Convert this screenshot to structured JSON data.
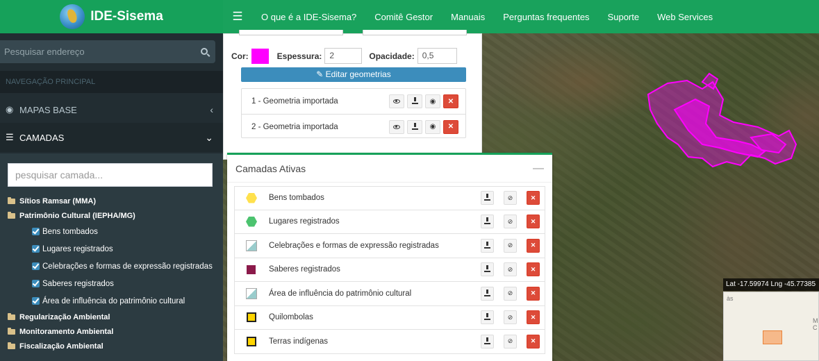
{
  "app": {
    "title": "IDE-Sisema"
  },
  "topnav": {
    "menu_icon": "hamburger-icon",
    "items": [
      "O que é a IDE-Sisema?",
      "Comitê Gestor",
      "Manuais",
      "Perguntas frequentes",
      "Suporte",
      "Web Services"
    ]
  },
  "sidebar": {
    "address_search": {
      "placeholder": "Pesquisar endereço",
      "icon": "search-icon"
    },
    "section_header": "NAVEGAÇÃO PRINCIPAL",
    "mapas_base": {
      "label": "MAPAS BASE",
      "icon": "globe-icon",
      "chevron": "‹"
    },
    "camadas": {
      "label": "CAMADAS",
      "icon": "list-icon",
      "chevron": "⌄"
    },
    "layer_search": {
      "placeholder": "pesquisar camada..."
    },
    "tree": [
      {
        "label": "Sítios Ramsar (MMA)",
        "type": "folder"
      },
      {
        "label": "Patrimônio Cultural (IEPHA/MG)",
        "type": "folder-open"
      },
      {
        "label": "Bens tombados",
        "type": "checked"
      },
      {
        "label": "Lugares registrados",
        "type": "checked"
      },
      {
        "label": "Celebrações e formas de expressão registradas",
        "type": "checked"
      },
      {
        "label": "Saberes registrados",
        "type": "checked"
      },
      {
        "label": "Área de influência do patrimônio cultural",
        "type": "checked"
      },
      {
        "label": "Regularização Ambiental",
        "type": "folder"
      },
      {
        "label": "Monitoramento Ambiental",
        "type": "folder"
      },
      {
        "label": "Fiscalização Ambiental",
        "type": "folder"
      }
    ]
  },
  "draw_panel": {
    "color_label": "Cor:",
    "color_value": "#ff00ff",
    "thickness_label": "Espessura:",
    "thickness_value": "2",
    "opacity_label": "Opacidade:",
    "opacity_value": "0,5",
    "edit_button": "Editar geometrias",
    "geometries": [
      {
        "label": "1 - Geometria importada"
      },
      {
        "label": "2 - Geometria importada"
      }
    ]
  },
  "active_layers": {
    "title": "Camadas Ativas",
    "minimize": "—",
    "items": [
      {
        "label": "Bens tombados",
        "symbol": "yellow-hexagon"
      },
      {
        "label": "Lugares registrados",
        "symbol": "green-hexagon"
      },
      {
        "label": "Celebrações e formas de expressão registradas",
        "symbol": "broken-image"
      },
      {
        "label": "Saberes registrados",
        "symbol": "maroon-square"
      },
      {
        "label": "Área de influência do patrimônio cultural",
        "symbol": "broken-image"
      },
      {
        "label": "Quilombolas",
        "symbol": "yellow-square"
      },
      {
        "label": "Terras indígenas",
        "symbol": "yellow-square"
      }
    ]
  },
  "map": {
    "coordinates": "Lat -17.59974 Lng -45.77385",
    "minimap_label": "às",
    "minimap_label2": "M C",
    "overlay_color": "#ff00ff"
  }
}
